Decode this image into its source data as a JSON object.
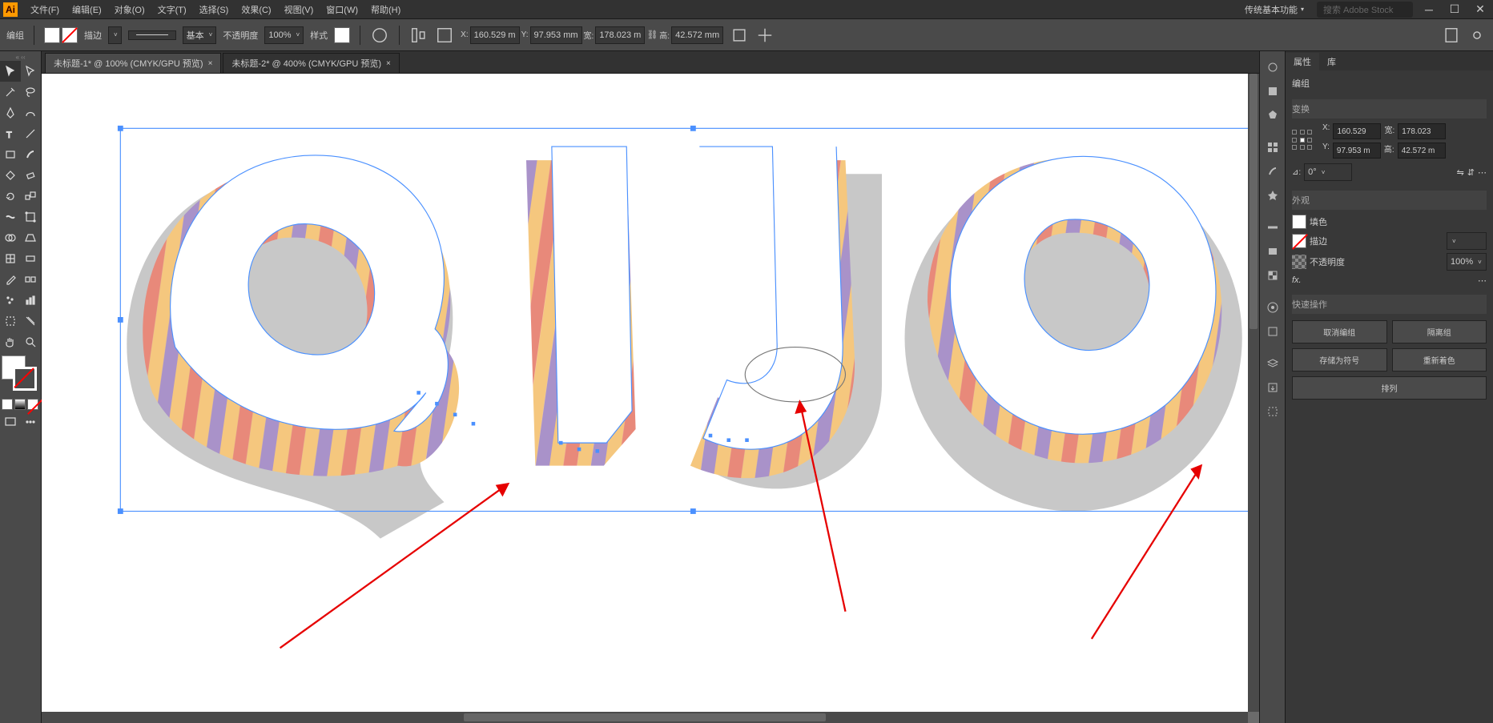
{
  "menubar": {
    "items": [
      "文件(F)",
      "编辑(E)",
      "对象(O)",
      "文字(T)",
      "选择(S)",
      "效果(C)",
      "视图(V)",
      "窗口(W)",
      "帮助(H)"
    ],
    "workspace": "传统基本功能",
    "search_placeholder": "搜索 Adobe Stock"
  },
  "controlbar": {
    "mode": "编组",
    "stroke_label": "描边",
    "stroke_weight": "",
    "stroke_style": "基本",
    "opacity_label": "不透明度",
    "opacity": "100%",
    "style_label": "样式",
    "x_label": "X:",
    "x": "160.529 m",
    "y_label": "Y:",
    "y": "97.953 mm",
    "w_label": "宽:",
    "w": "178.023 m",
    "h_label": "高:",
    "h": "42.572 mm"
  },
  "tabs": [
    {
      "label": "未标题-1* @ 100% (CMYK/GPU 预览)",
      "active": false
    },
    {
      "label": "未标题-2* @ 400% (CMYK/GPU 预览)",
      "active": true
    }
  ],
  "properties": {
    "tab_properties": "属性",
    "tab_libraries": "库",
    "group_label": "编组",
    "transform_label": "变换",
    "x_label": "X:",
    "x": "160.529",
    "y_label": "Y:",
    "y": "97.953 m",
    "w_label": "宽:",
    "w": "178.023",
    "h_label": "高:",
    "h": "42.572 m",
    "angle_label": "⊿:",
    "angle": "0°",
    "appearance_label": "外观",
    "fill_label": "填色",
    "stroke_label": "描边",
    "stroke_weight": "",
    "opacity_label": "不透明度",
    "opacity": "100%",
    "quick_label": "快速操作",
    "btn_ungroup": "取消编组",
    "btn_isolate": "隔离组",
    "btn_save_symbol": "存储为符号",
    "btn_recolor": "重新着色",
    "btn_arrange": "排列"
  },
  "tools": [
    [
      "selection",
      "direct-selection"
    ],
    [
      "magic-wand",
      "lasso"
    ],
    [
      "pen",
      "curvature"
    ],
    [
      "type",
      "line"
    ],
    [
      "rectangle",
      "brush"
    ],
    [
      "shaper",
      "eraser"
    ],
    [
      "rotate",
      "scale"
    ],
    [
      "width",
      "free-transform"
    ],
    [
      "shape-builder",
      "perspective"
    ],
    [
      "mesh",
      "gradient"
    ],
    [
      "eyedropper",
      "blend"
    ],
    [
      "symbol-spray",
      "graph"
    ],
    [
      "artboard",
      "slice"
    ],
    [
      "hand",
      "zoom"
    ]
  ],
  "dock_icons": [
    "properties",
    "color",
    "color-guide",
    "swatches",
    "brushes",
    "symbols",
    "stroke",
    "gradient",
    "transparency",
    "appearance",
    "graphic-styles",
    "layers",
    "asset-export",
    "artboards"
  ]
}
